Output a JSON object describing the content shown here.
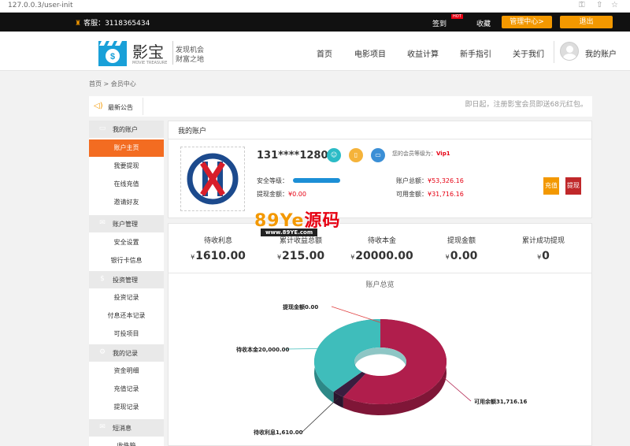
{
  "browser": {
    "url": "127.0.0.3/user-init"
  },
  "topbar": {
    "service_label": "客服：3118365434",
    "signin": "签到",
    "hot_badge": "HOT",
    "favorite": "收藏",
    "manage_button": "管理中心>",
    "logout_button": "退出"
  },
  "header": {
    "logo_name": "影宝",
    "logo_sub": "MOVIE TREASURE",
    "slogan_line1": "发现机会",
    "slogan_line2": "财富之地",
    "nav": [
      "首页",
      "电影项目",
      "收益计算",
      "新手指引",
      "关于我们"
    ],
    "my_account": "我的账户"
  },
  "breadcrumb": "首页 > 会员中心",
  "notice": {
    "title": "最新公告",
    "text": "即日起，注册影宝会员即送68元红包。"
  },
  "sidebar": {
    "groups": [
      {
        "label": "我的账户",
        "items": [
          "账户主页",
          "我要提现",
          "在线充值",
          "邀请好友"
        ]
      },
      {
        "label": "账户管理",
        "items": [
          "安全设置",
          "银行卡信息"
        ]
      },
      {
        "label": "投资管理",
        "items": [
          "投资记录",
          "付息还本记录",
          "可投项目"
        ]
      },
      {
        "label": "我的记录",
        "items": [
          "资金明细",
          "充值记录",
          "提现记录"
        ]
      },
      {
        "label": "短消息",
        "items": [
          "收件箱"
        ]
      }
    ],
    "active_item": "账户主页"
  },
  "account": {
    "title": "我的账户",
    "username": "131****1280",
    "level_prefix": "您的会员等级为：",
    "level": "Vip1",
    "security_label": "安全等级：",
    "withdraw_label": "提现金额：",
    "withdraw_value": "¥0.00",
    "total_label": "账户总额：",
    "total_value": "¥53,326.16",
    "available_label": "可用金额：",
    "available_value": "¥31,716.16",
    "recharge_button": "充值",
    "withdraw_button": "提现"
  },
  "stats": [
    {
      "label": "待收利息",
      "currency": "¥",
      "value": "1610.00"
    },
    {
      "label": "累计收益总额",
      "currency": "¥",
      "value": "215.00"
    },
    {
      "label": "待收本金",
      "currency": "¥",
      "value": "20000.00"
    },
    {
      "label": "提现金额",
      "currency": "¥",
      "value": "0.00"
    },
    {
      "label": "累计成功提现",
      "currency": "¥",
      "value": "0"
    }
  ],
  "watermark": {
    "brand": "89Ye",
    "han": "源码",
    "url": "www.89YE.com"
  },
  "chart_data": {
    "type": "pie",
    "title": "账户总览",
    "variant": "3d-donut",
    "series": [
      {
        "label": "可用余额31,716.16",
        "value": 31716.16,
        "color": "#b01e4c"
      },
      {
        "label": "待收利息1,610.00",
        "value": 1610.0,
        "color": "#3a1d3f"
      },
      {
        "label": "待收本金20,000.00",
        "value": 20000.0,
        "color": "#3fbdbb"
      },
      {
        "label": "提现金额0.00",
        "value": 0.0,
        "color": "#e04040"
      }
    ]
  }
}
